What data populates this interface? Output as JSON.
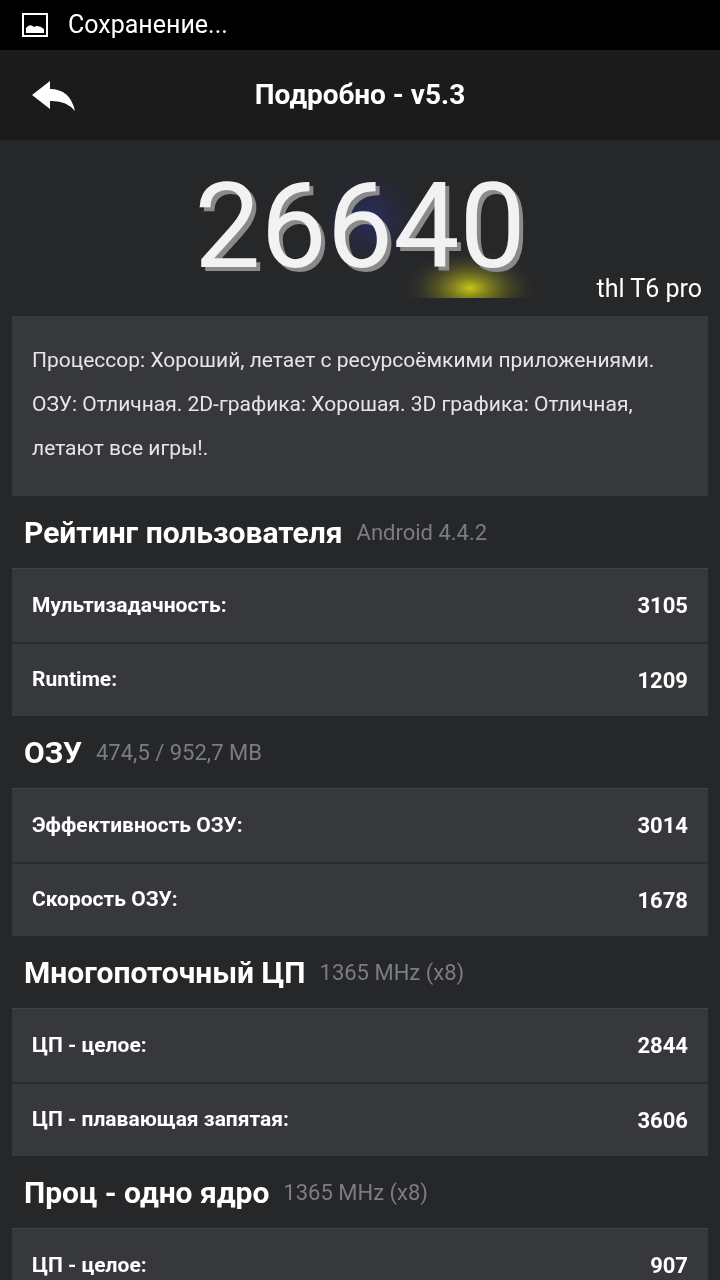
{
  "status_bar": {
    "notification": "Сохранение..."
  },
  "action_bar": {
    "title": "Подробно - v5.3"
  },
  "score": {
    "value": "26640",
    "device": "thl T6 pro"
  },
  "description": "Процессор: Хороший, летает с ресурсоёмкими приложениями. ОЗУ: Отличная. 2D-графика: Хорошая. 3D графика: Отличная, летают все игры!.",
  "sections": [
    {
      "title": "Рейтинг пользователя",
      "subtitle": "Android 4.4.2",
      "rows": [
        {
          "label": "Мультизадачность:",
          "value": "3105"
        },
        {
          "label": "Runtime:",
          "value": "1209"
        }
      ]
    },
    {
      "title": "ОЗУ",
      "subtitle": "474,5 / 952,7 MB",
      "rows": [
        {
          "label": "Эффективность ОЗУ:",
          "value": "3014"
        },
        {
          "label": "Скорость ОЗУ:",
          "value": "1678"
        }
      ]
    },
    {
      "title": "Многопоточный ЦП",
      "subtitle": "1365 MHz (x8)",
      "rows": [
        {
          "label": "ЦП - целое:",
          "value": "2844"
        },
        {
          "label": "ЦП - плавающая запятая:",
          "value": "3606"
        }
      ]
    },
    {
      "title": "Проц - одно ядро",
      "subtitle": "1365 MHz (x8)",
      "rows": [
        {
          "label": "ЦП - целое:",
          "value": "907"
        }
      ]
    }
  ]
}
